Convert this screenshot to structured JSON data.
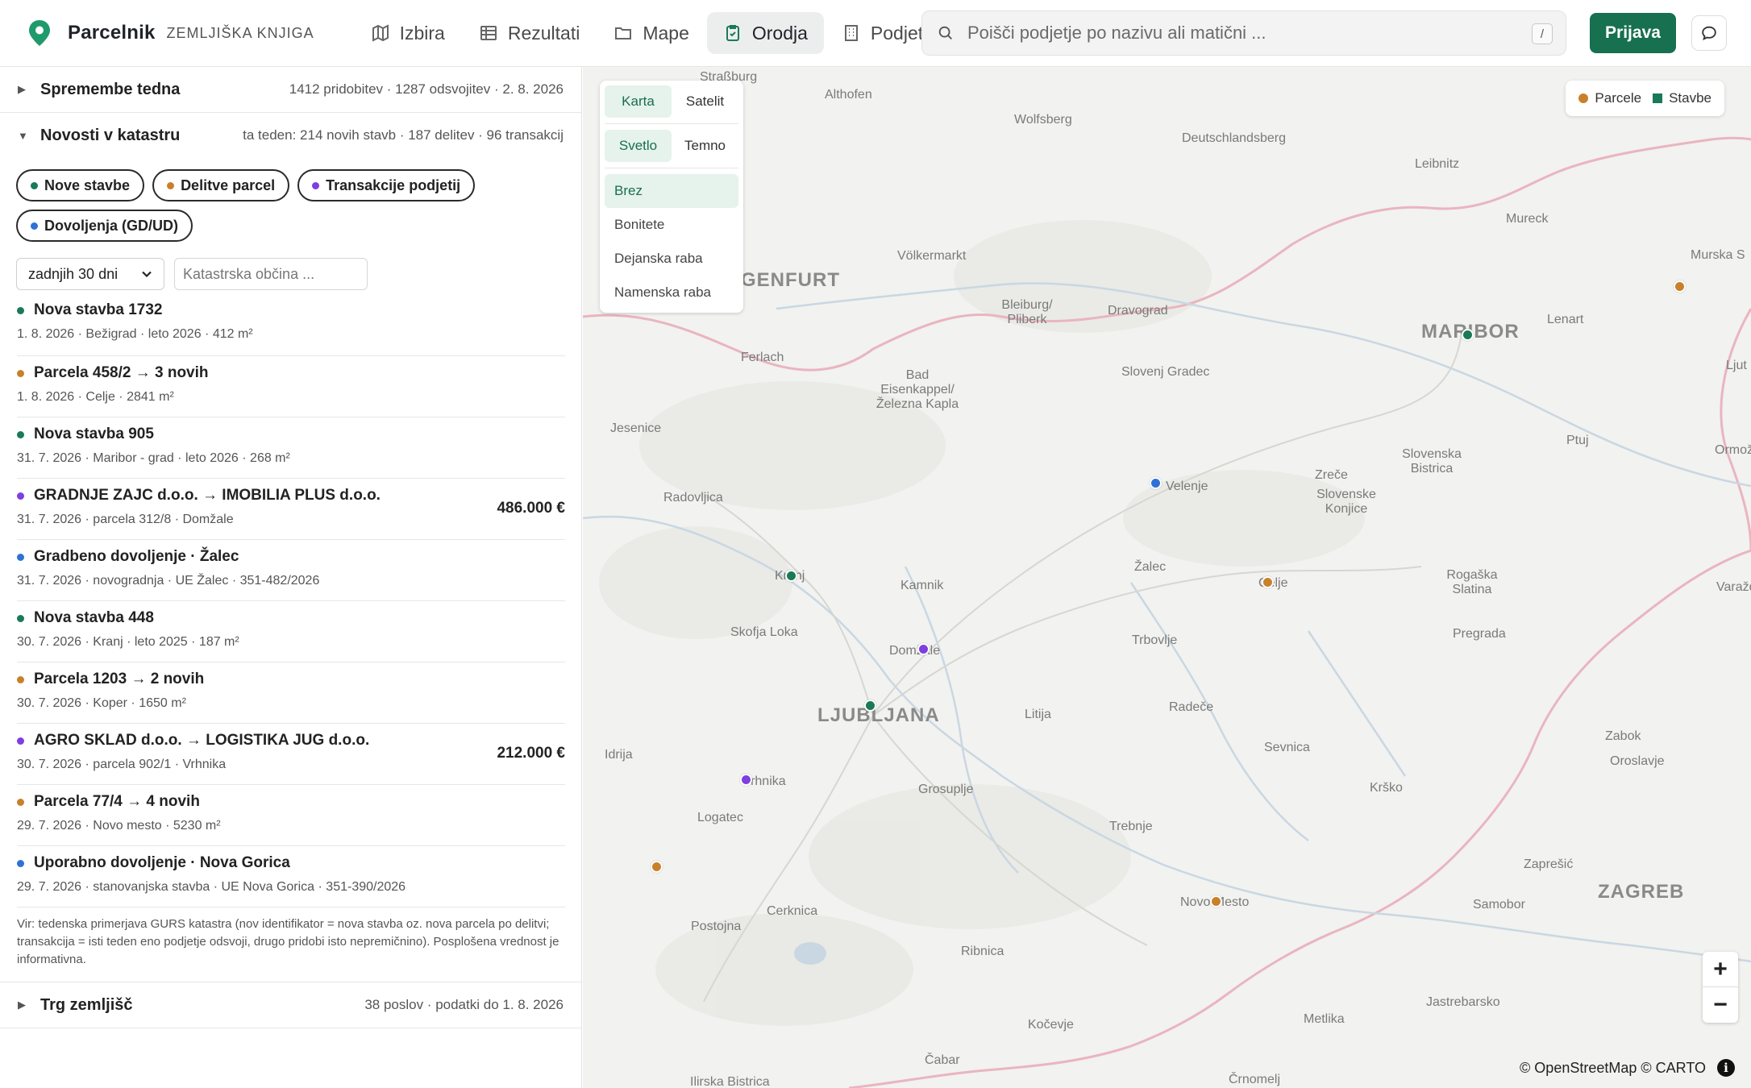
{
  "header": {
    "brand_name": "Parcelnik",
    "brand_sub": "ZEMLJIŠKA KNJIGA",
    "nav": [
      {
        "label": "Izbira",
        "icon": "map-icon"
      },
      {
        "label": "Rezultati",
        "icon": "table-icon"
      },
      {
        "label": "Mape",
        "icon": "folder-icon"
      },
      {
        "label": "Orodja",
        "icon": "clipboard-icon",
        "active": true
      },
      {
        "label": "Podjetja",
        "icon": "building-icon"
      }
    ],
    "search_placeholder": "Poišči podjetje po nazivu ali matični ...",
    "search_shortcut": "/",
    "login_label": "Prijava",
    "accent": "#17704f"
  },
  "panel": {
    "weekly": {
      "title": "Spremembe tedna",
      "meta": "1412 pridobitev · 1287 odsvojitev · 2. 8. 2026"
    },
    "cadastre": {
      "title": "Novosti v katastru",
      "meta": "ta teden: 214 novih stavb · 187 delitev · 96 transakcij"
    },
    "chips": [
      {
        "label": "Nove stavbe",
        "color": "#1a7a57"
      },
      {
        "label": "Delitve parcel",
        "color": "#c8812a"
      },
      {
        "label": "Transakcije podjetij",
        "color": "#7d3fe0"
      },
      {
        "label": "Dovoljenja (GD/UD)",
        "color": "#2f72d6"
      }
    ],
    "period": "zadnjih 30 dni",
    "kat_placeholder": "Katastrska občina ...",
    "feed": [
      {
        "title": "Nova stavba 1732",
        "meta": "1. 8. 2026 · Bežigrad · leto 2026 · 412 m²",
        "color": "#1a7a57",
        "value": ""
      },
      {
        "title": "Parcela 458/2 → 3 novih",
        "meta": "1. 8. 2026 · Celje · 2841 m²",
        "color": "#c8812a",
        "value": ""
      },
      {
        "title": "Nova stavba 905",
        "meta": "31. 7. 2026 · Maribor - grad · leto 2026 · 268 m²",
        "color": "#1a7a57",
        "value": ""
      },
      {
        "title": "GRADNJE ZAJC d.o.o. → IMOBILIA PLUS d.o.o.",
        "meta": "31. 7. 2026 · parcela 312/8 · Domžale",
        "color": "#7d3fe0",
        "value": "486.000 €"
      },
      {
        "title": "Gradbeno dovoljenje · Žalec",
        "meta": "31. 7. 2026 · novogradnja · UE Žalec · 351-482/2026",
        "color": "#2f72d6",
        "value": ""
      },
      {
        "title": "Nova stavba 448",
        "meta": "30. 7. 2026 · Kranj · leto 2025 · 187 m²",
        "color": "#1a7a57",
        "value": ""
      },
      {
        "title": "Parcela 1203 → 2 novih",
        "meta": "30. 7. 2026 · Koper · 1650 m²",
        "color": "#c8812a",
        "value": ""
      },
      {
        "title": "AGRO SKLAD d.o.o. → LOGISTIKA JUG d.o.o.",
        "meta": "30. 7. 2026 · parcela 902/1 · Vrhnika",
        "color": "#7d3fe0",
        "value": "212.000 €"
      },
      {
        "title": "Parcela 77/4 → 4 novih",
        "meta": "29. 7. 2026 · Novo mesto · 5230 m²",
        "color": "#c8812a",
        "value": ""
      },
      {
        "title": "Uporabno dovoljenje · Nova Gorica",
        "meta": "29. 7. 2026 · stanovanjska stavba · UE Nova Gorica · 351-390/2026",
        "color": "#2f72d6",
        "value": ""
      }
    ],
    "source_note": "Vir: tedenska primerjava GURS katastra (nov identifikator = nova stavba oz. nova parcela po delitvi; transakcija = isti teden eno podjetje odsvoji, drugo pridobi isto nepremičnino). Posplošena vrednost je informativna.",
    "market": {
      "title": "Trg zemljišč",
      "meta": "38 poslov · podatki do 1. 8. 2026"
    }
  },
  "map": {
    "base_tabs": [
      "Karta",
      "Satelit"
    ],
    "theme_tabs": [
      "Svetlo",
      "Temno"
    ],
    "overlays": [
      "Brez",
      "Bonitete",
      "Dejanska raba",
      "Namenska raba"
    ],
    "legend": [
      {
        "label": "Parcele",
        "color": "#c8812a"
      },
      {
        "label": "Stavbe",
        "color": "#1a7a57"
      }
    ],
    "zoom_in": "+",
    "zoom_out": "−",
    "attribution": "© OpenStreetMap © CARTO",
    "info": "i",
    "places": [
      "Straßburg",
      "Althofen",
      "Wolfsberg",
      "Deutschlandsberg",
      "Leibnitz",
      "Mureck",
      "Murska S",
      "GENFURT",
      "Völkermarkt",
      "Bleiburg/ Pliberk",
      "Dravograd",
      "MARIBOR",
      "Lenart",
      "Ferlach",
      "Bad Eisenkappel/ Železna Kapla",
      "Slovenj Gradec",
      "Ljut",
      "Jesenice",
      "Ptuj",
      "Ormož",
      "Slovenska Bistrica",
      "Zreče",
      "Slovenske Konjice",
      "Velenje",
      "Radovljica",
      "Žalec",
      "Celje",
      "Rogaška Slatina",
      "Varaždin",
      "Kranj",
      "Kamnik",
      "Skofja Loka",
      "Domžale",
      "Trbovlje",
      "Pregrada",
      "LJUBLJANA",
      "Litija",
      "Radeče",
      "Zabok",
      "Oroslavje",
      "Sevnica",
      "Idrija",
      "Vrhnika",
      "Grosuplje",
      "Logatec",
      "Krško",
      "Trebnje",
      "Zaprešić",
      "Novo Mesto",
      "Samobor",
      "ZAGREB",
      "Cerknica",
      "Postojna",
      "Ribnica",
      "Jastrebarsko",
      "Kočevje",
      "Metlika",
      "Čabar",
      "Ilirska Bistrica",
      "Črnomelj"
    ]
  }
}
